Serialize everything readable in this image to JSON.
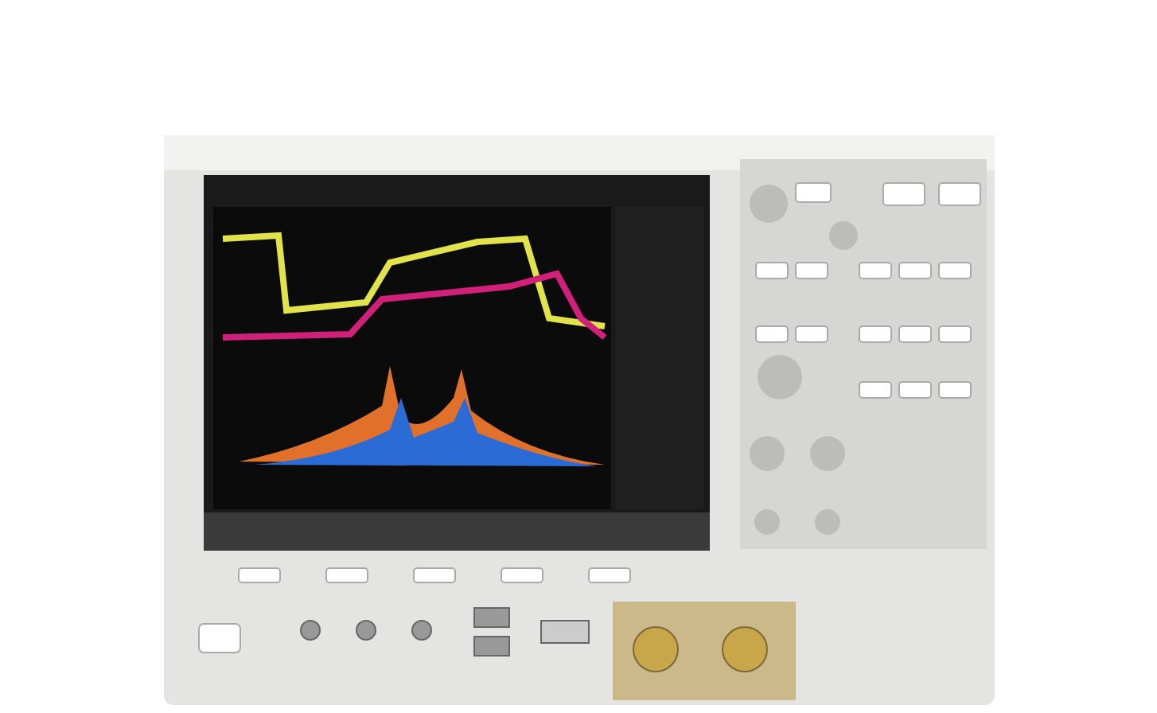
{
  "picture": {
    "kind": "photo"
  }
}
